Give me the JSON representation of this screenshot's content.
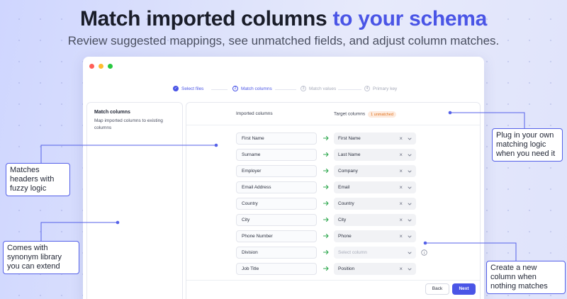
{
  "hero": {
    "title_plain": "Match imported columns ",
    "title_accent": "to your schema",
    "subtitle": "Review suggested mappings, see unmatched fields, and adjust column matches."
  },
  "colors": {
    "accent": "#4a55e6",
    "arrow_green": "#2fa84f",
    "badge_orange": "#e0731f",
    "traffic_red": "#ff5f57",
    "traffic_yellow": "#febc2e",
    "traffic_green": "#28c840"
  },
  "steps": [
    {
      "label": "Select files",
      "number": "✓",
      "state": "done"
    },
    {
      "label": "Match columns",
      "number": "2",
      "state": "active"
    },
    {
      "label": "Match values",
      "number": "3",
      "state": "todo"
    },
    {
      "label": "Primary key",
      "number": "4",
      "state": "todo"
    }
  ],
  "sidebar": {
    "title": "Match columns",
    "description": "Map imported columns to existing columns"
  },
  "table": {
    "imported_header": "Imported columns",
    "target_header": "Target columns",
    "unmatched_badge": "1 unmatched",
    "rows": [
      {
        "source": "First Name",
        "target": "First Name"
      },
      {
        "source": "Surname",
        "target": "Last Name"
      },
      {
        "source": "Employer",
        "target": "Company"
      },
      {
        "source": "Email Address",
        "target": "Email"
      },
      {
        "source": "Country",
        "target": "Country"
      },
      {
        "source": "City",
        "target": "City"
      },
      {
        "source": "Phone Number",
        "target": "Phone"
      },
      {
        "source": "Division",
        "target": "",
        "placeholder": "Select column"
      },
      {
        "source": "Job Title",
        "target": "Position"
      }
    ]
  },
  "footer": {
    "back_label": "Back",
    "next_label": "Next"
  },
  "callouts": {
    "fuzzy": "Matches headers with fuzzy logic",
    "synonym": "Comes with synonym library you can extend",
    "plugin": "Plug in your own matching logic when you need it",
    "new_column": "Create a new column when nothing matches"
  },
  "icons": {
    "step_done": "check-circle-icon",
    "arrow": "arrow-right-icon",
    "clear": "close-icon",
    "dropdown": "chevron-down-icon",
    "info": "info-icon"
  }
}
